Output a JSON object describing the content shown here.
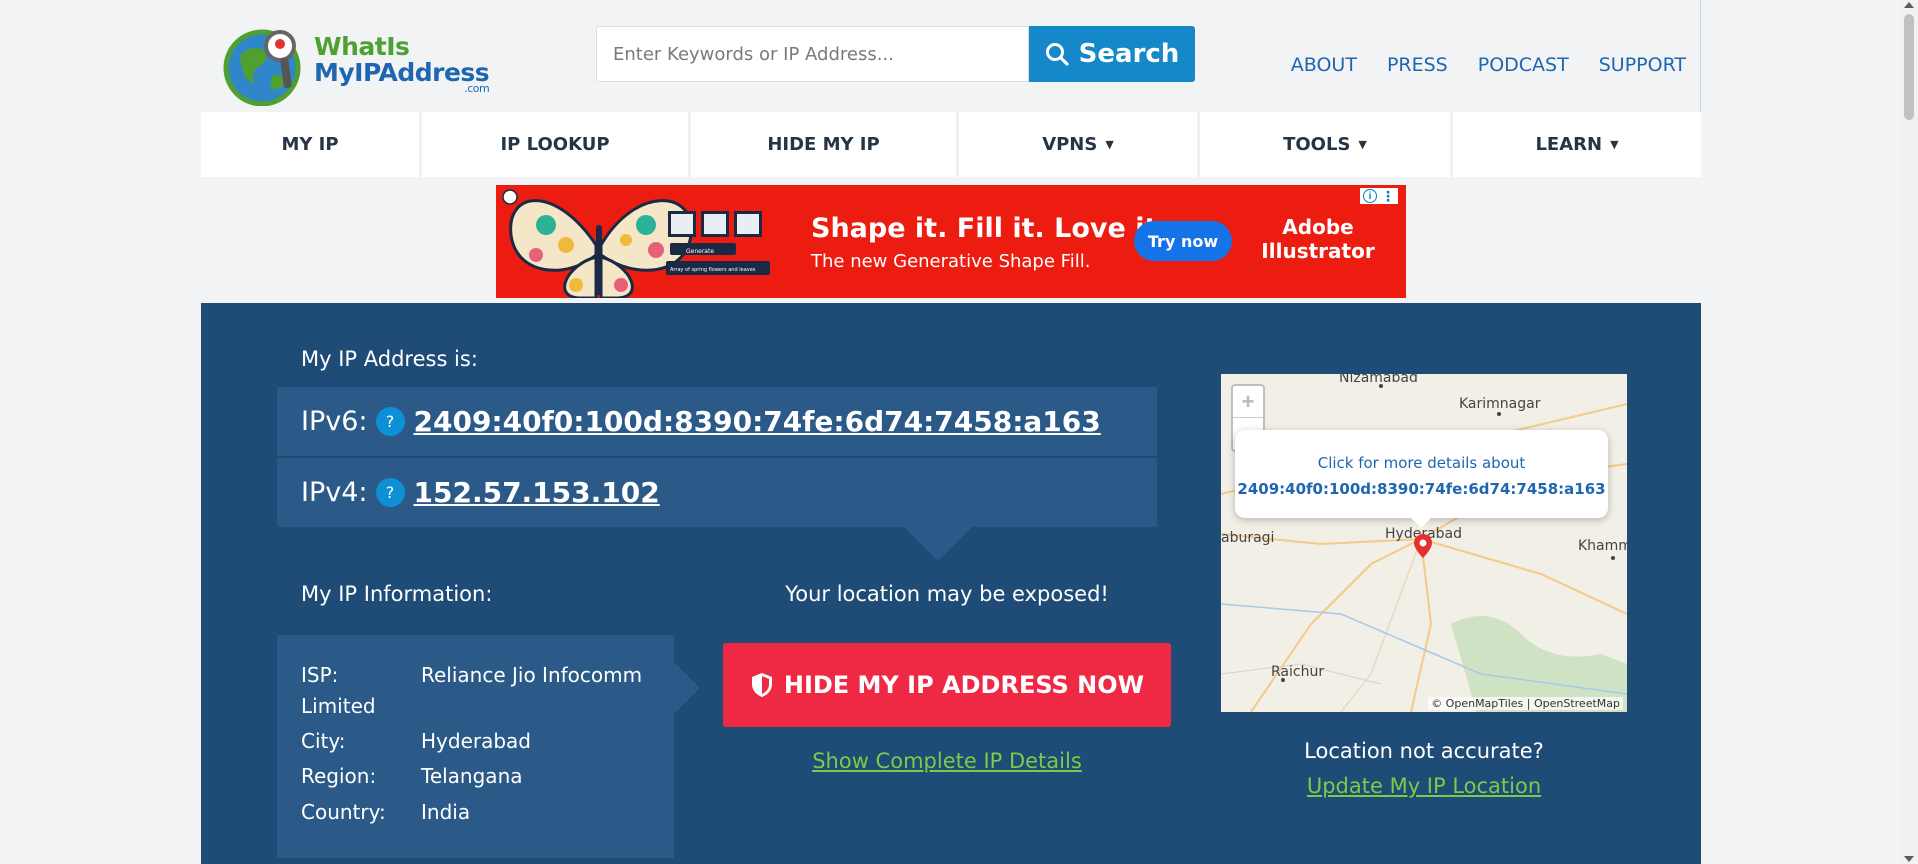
{
  "header": {
    "logo": {
      "line1": "WhatIs",
      "line2": "MyIPAddress",
      "line3": ".com"
    },
    "search": {
      "placeholder": "Enter Keywords or IP Address...",
      "button_label": "Search"
    },
    "top_links": [
      "ABOUT",
      "PRESS",
      "PODCAST",
      "SUPPORT"
    ]
  },
  "nav": {
    "items": [
      {
        "label": "MY IP",
        "has_dropdown": false
      },
      {
        "label": "IP LOOKUP",
        "has_dropdown": false
      },
      {
        "label": "HIDE MY IP",
        "has_dropdown": false
      },
      {
        "label": "VPNS",
        "has_dropdown": true
      },
      {
        "label": "TOOLS",
        "has_dropdown": true
      },
      {
        "label": "LEARN",
        "has_dropdown": true
      }
    ],
    "caret": "▼"
  },
  "ad": {
    "headline": "Shape it. Fill it. Love it.",
    "subline": "The new Generative Shape Fill.",
    "cta": "Try now",
    "brand_line1": "Adobe",
    "brand_line2": "Illustrator",
    "art_button": "Generate",
    "art_caption": "Array of spring flowers and leaves",
    "background_color": "#ec1c10"
  },
  "ip": {
    "heading": "My IP Address is:",
    "ipv6_label": "IPv6:",
    "ipv6_value": "2409:40f0:100d:8390:74fe:6d74:7458:a163",
    "ipv4_label": "IPv4:",
    "ipv4_value": "152.57.153.102",
    "help_symbol": "?"
  },
  "info": {
    "heading": "My IP Information:",
    "rows": [
      {
        "key": "ISP:",
        "value": "Reliance Jio Infocomm",
        "value_wrap": "Limited"
      },
      {
        "key": "City:",
        "value": "Hyderabad"
      },
      {
        "key": "Region:",
        "value": "Telangana"
      },
      {
        "key": "Country:",
        "value": "India"
      }
    ]
  },
  "cta": {
    "warning": "Your location may be exposed!",
    "button_label": "HIDE MY IP ADDRESS NOW",
    "details_link": "Show Complete IP Details",
    "button_color": "#ef2843"
  },
  "map": {
    "zoom_in": "+",
    "zoom_out": "−",
    "cities": [
      "Nizamabad",
      "Karimnagar",
      "aburagi",
      "Hyderabad",
      "Khamm",
      "Raichur"
    ],
    "popup_line1": "Click for more details about",
    "popup_line2": "2409:40f0:100d:8390:74fe:6d74:7458:a163",
    "attribution": "© OpenMapTiles | OpenStreetMap"
  },
  "location": {
    "question": "Location not accurate?",
    "update_link": "Update My IP Location"
  },
  "colors": {
    "brand_blue": "#1f66b1",
    "panel_navy": "#1f4b77",
    "panel_row": "#2b5a88",
    "link_green": "#7ec94a",
    "search_blue": "#1588c9"
  }
}
